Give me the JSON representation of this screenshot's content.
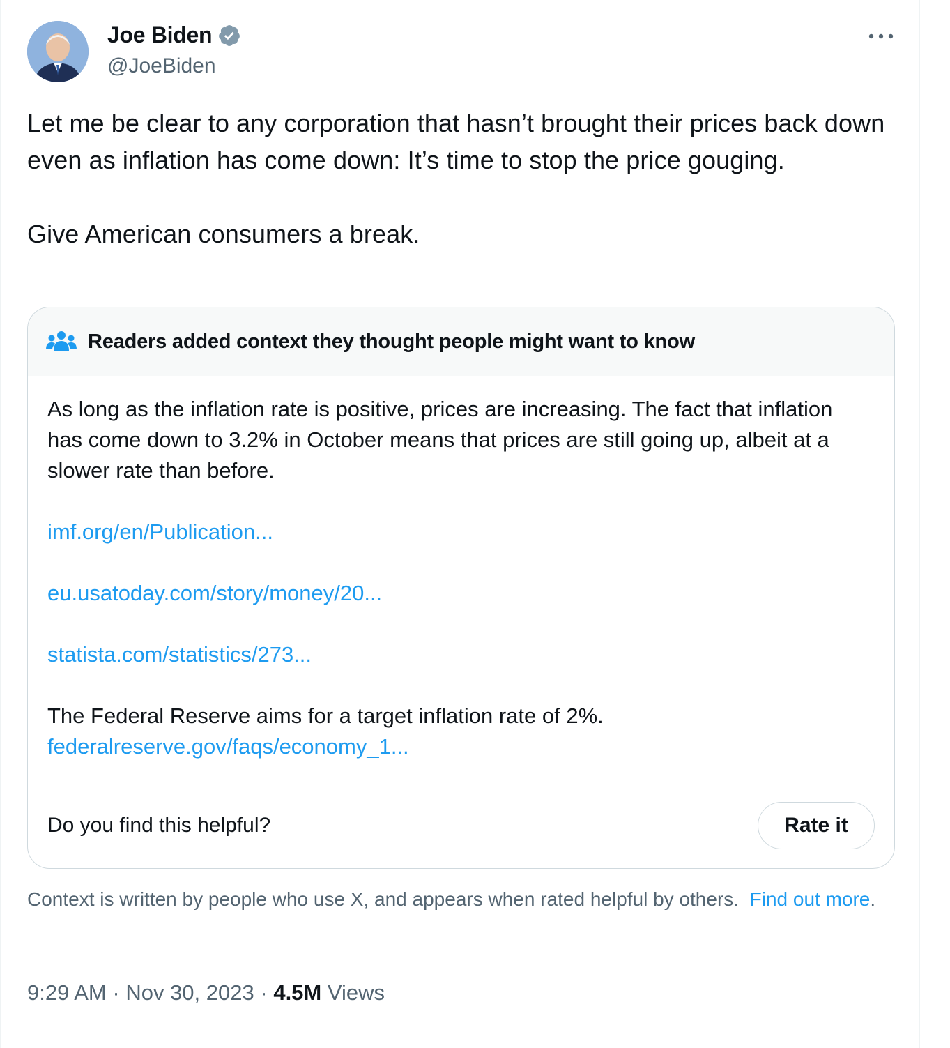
{
  "author": {
    "name": "Joe Biden",
    "handle": "@JoeBiden",
    "verified": true
  },
  "tweet": {
    "text": "Let me be clear to any corporation that hasn’t brought their prices back down even as inflation has come down: It’s time to stop the price gouging.\n\nGive American consumers a break."
  },
  "community_note": {
    "header": "Readers added context they thought people might want to know",
    "paragraph": "As long as the inflation rate is positive, prices are increasing. The fact that inflation has come down to 3.2% in October means that prices are still going up, albeit at a slower rate than before.",
    "links": [
      "imf.org/en/Publication...",
      "eu.usatoday.com/story/money/20...",
      "statista.com/statistics/273..."
    ],
    "fed_text": "The Federal Reserve aims for a target inflation rate of 2%.",
    "fed_link": "federalreserve.gov/faqs/economy_1...",
    "helpful_prompt": "Do you find this helpful?",
    "rate_button": "Rate it"
  },
  "context_footer": {
    "text": "Context is written by people who use X, and appears when rated helpful by others.",
    "link": "Find out more",
    "tail": "."
  },
  "meta": {
    "time": "9:29 AM",
    "date": "Nov 30, 2023",
    "views_count": "4.5M",
    "views_label": "Views",
    "separator": "·"
  },
  "icons": {
    "verified": "verified-badge-icon",
    "more": "more-options-icon",
    "people": "community-notes-people-icon"
  },
  "colors": {
    "link": "#1d9bf0",
    "secondary_text": "#536471",
    "border": "#cfd9de",
    "note_header_bg": "#f7f9f9"
  }
}
